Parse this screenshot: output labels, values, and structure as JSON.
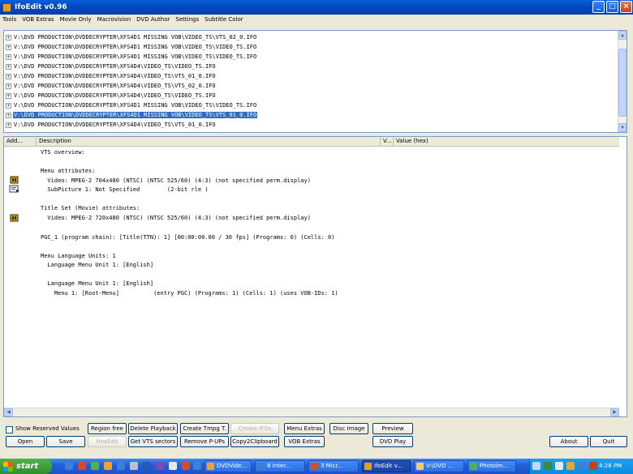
{
  "window": {
    "title": "IfoEdit v0.96",
    "controls": [
      "minimize",
      "maximize",
      "close"
    ]
  },
  "menu": [
    "Tools",
    "VOB Extras",
    "Movie Only",
    "Macrovision",
    "DVD Author",
    "Settings",
    "Subtitle Color"
  ],
  "tree": {
    "items": [
      "V:\\DVD PRODUCTION\\DVDDECRYPTER\\XFS4D1 MISSING VOB\\VIDEO_TS\\VTS_02_0.IFO",
      "V:\\DVD PRODUCTION\\DVDDECRYPTER\\XFS4D1 MISSING VOB\\VIDEO_TS\\VIDEO_TS.IFO",
      "V:\\DVD PRODUCTION\\DVDDECRYPTER\\XFS4D1 MISSING VOB\\VIDEO_TS\\VIDEO_TS.IFO",
      "V:\\DVD PRODUCTION\\DVDDECRYPTER\\XFS4D4\\VIDEO_TS\\VIDEO_TS.IFO",
      "V:\\DVD PRODUCTION\\DVDDECRYPTER\\XFS4D4\\VIDEO_TS\\VTS_01_0.IFO",
      "V:\\DVD PRODUCTION\\DVDDECRYPTER\\XFS4D4\\VIDEO_TS\\VTS_02_0.IFO",
      "V:\\DVD PRODUCTION\\DVDDECRYPTER\\XFS4D4\\VIDEO_TS\\VIDEO_TS.IFO",
      "V:\\DVD PRODUCTION\\DVDDECRYPTER\\XFS4D1 MISSING VOB\\VIDEO_TS\\VIDEO_TS.IFO",
      "V:\\DVD PRODUCTION\\DVDDECRYPTER\\XFS4D1 MISSING VOB\\VIDEO_TS\\VTS_01_0.IFO",
      "V:\\DVD PRODUCTION\\DVDDECRYPTER\\XFS4D4\\VIDEO_TS\\VTS_01_0.IFO"
    ],
    "selected_index": 8
  },
  "list": {
    "columns": [
      "Add...",
      "Description",
      "V...",
      "Value (hex)"
    ],
    "lines": [
      "VTS overview:",
      "",
      "Menu attributes:",
      "  Video: MPEG-2 704x480 (NTSC) (NTSC 525/60) (4:3) (not specified perm.display)",
      "  SubPicture 1: Not Specified        (2-bit rle )",
      "",
      "Title Set (Movie) attributes:",
      "  Video: MPEG-2 720x480 (NTSC) (NTSC 525/60) (4:3) (not specified perm.display)",
      "",
      "PGC_1 (program chain): [Title(TTN): 1] [00:00:00.00 / 30 fps] (Programs: 0) (Cells: 0)",
      "",
      "Menu Language Units: 1",
      "  Language Menu Unit 1: [English]",
      "",
      "  Language Menu Unit 1: [English]",
      "    Menu 1: [Root-Menu]          (entry PGC) (Programs: 1) (Cells: 1) (uses VOB-IDs: 1)"
    ]
  },
  "controls": {
    "show_reserved_values": "Show Reserved Values",
    "region_free": "Region free",
    "delete_playback": "Delete Playback",
    "create_tmpg": "Create Tmpg T.",
    "create_ifos": "Create IFOs",
    "menu_extras": "Menu Extras",
    "disc_image": "Disc Image",
    "preview": "Preview",
    "open": "Open",
    "save": "Save",
    "hexedit": "HexEdit",
    "get_vts_sectors": "Get VTS sectors",
    "remove_pups": "Remove P-UPs",
    "copy2clipboard": "Copy2Clipboard",
    "vob_extras": "VOB Extras",
    "dvd_play": "DVD Play",
    "about": "About",
    "quit": "Quit"
  },
  "taskbar": {
    "start": "start",
    "tasks": [
      "DVDVide...",
      "8 Inter...",
      "3 Micr...",
      "IfoEdit v...",
      "V:\\DVD ...",
      "PhotoIm..."
    ],
    "active_index": 3,
    "clock": "4:28 PM"
  },
  "colors": {
    "selection": "#316ac5",
    "titlebar": "#0a5fd8",
    "taskbar": "#245edb",
    "start": "#3c9c3c"
  }
}
